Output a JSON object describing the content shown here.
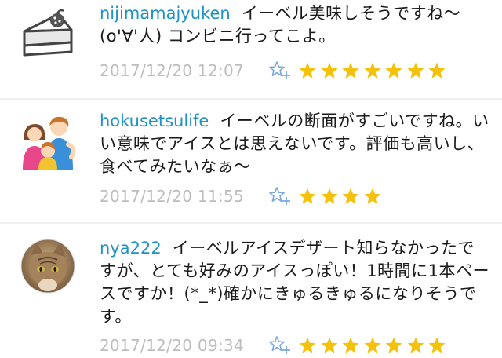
{
  "comments": [
    {
      "username": "nijimamajyuken",
      "text": "イーベル美味しそうですね〜(o'∀'人) コンビニ行ってこよ。",
      "timestamp": "2017/12/20 12:07",
      "stars": 7,
      "avatar_icon": "cake-slice-icon"
    },
    {
      "username": "hokusetsulife",
      "text": "イーベルの断面がすごいですね。いい意味でアイスとは思えないです。評価も高いし、食べてみたいなぁ〜",
      "timestamp": "2017/12/20 11:55",
      "stars": 4,
      "avatar_icon": "family-icon"
    },
    {
      "username": "nya222",
      "text": "イーベルアイスデザート知らなかったですが、とても好みのアイスっぽい！1時間に1本ペースですか！(*_*)確かにきゅるきゅるになりそうです。",
      "timestamp": "2017/12/20 09:34",
      "stars": 7,
      "avatar_icon": "cat-photo-icon"
    }
  ],
  "colors": {
    "username": "#1f93c8",
    "star": "#f4c20d",
    "timestamp": "#bdbdbd",
    "favorite_outline": "#7aa7de"
  }
}
